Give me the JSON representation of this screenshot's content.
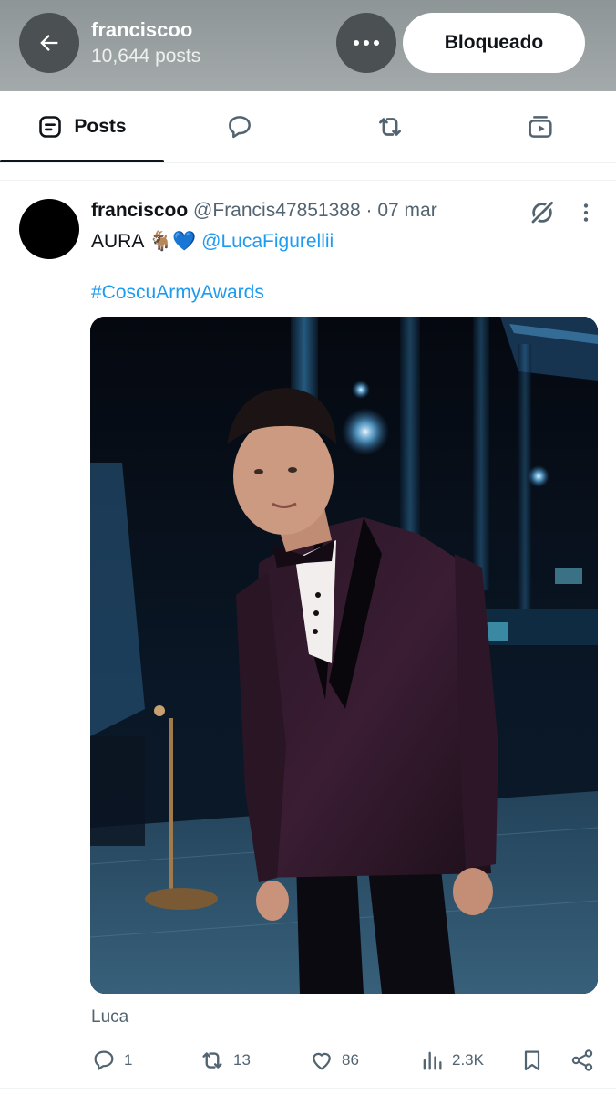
{
  "header": {
    "title": "franciscoo",
    "post_count": "10,644 posts",
    "blocked_label": "Bloqueado"
  },
  "tabs": [
    {
      "label": "Posts",
      "icon": "posts-icon",
      "active": true
    },
    {
      "icon": "replies-icon"
    },
    {
      "icon": "reposts-icon"
    },
    {
      "icon": "media-icon"
    }
  ],
  "post": {
    "author_name": "franciscoo",
    "handle": "@Francis47851388",
    "date": "· 07 mar",
    "text_start": "AURA ",
    "emoji": "🐐💙",
    "mention": "@LucaFigurellii",
    "hashtag": "#CoscuArmyAwards",
    "caption": "Luca",
    "stats": {
      "replies": "1",
      "reposts": "13",
      "likes": "86",
      "views": "2.3K"
    }
  },
  "colors": {
    "accent": "#1d9bf0",
    "header_bg": "#9aa0a1",
    "muted": "#536471"
  }
}
